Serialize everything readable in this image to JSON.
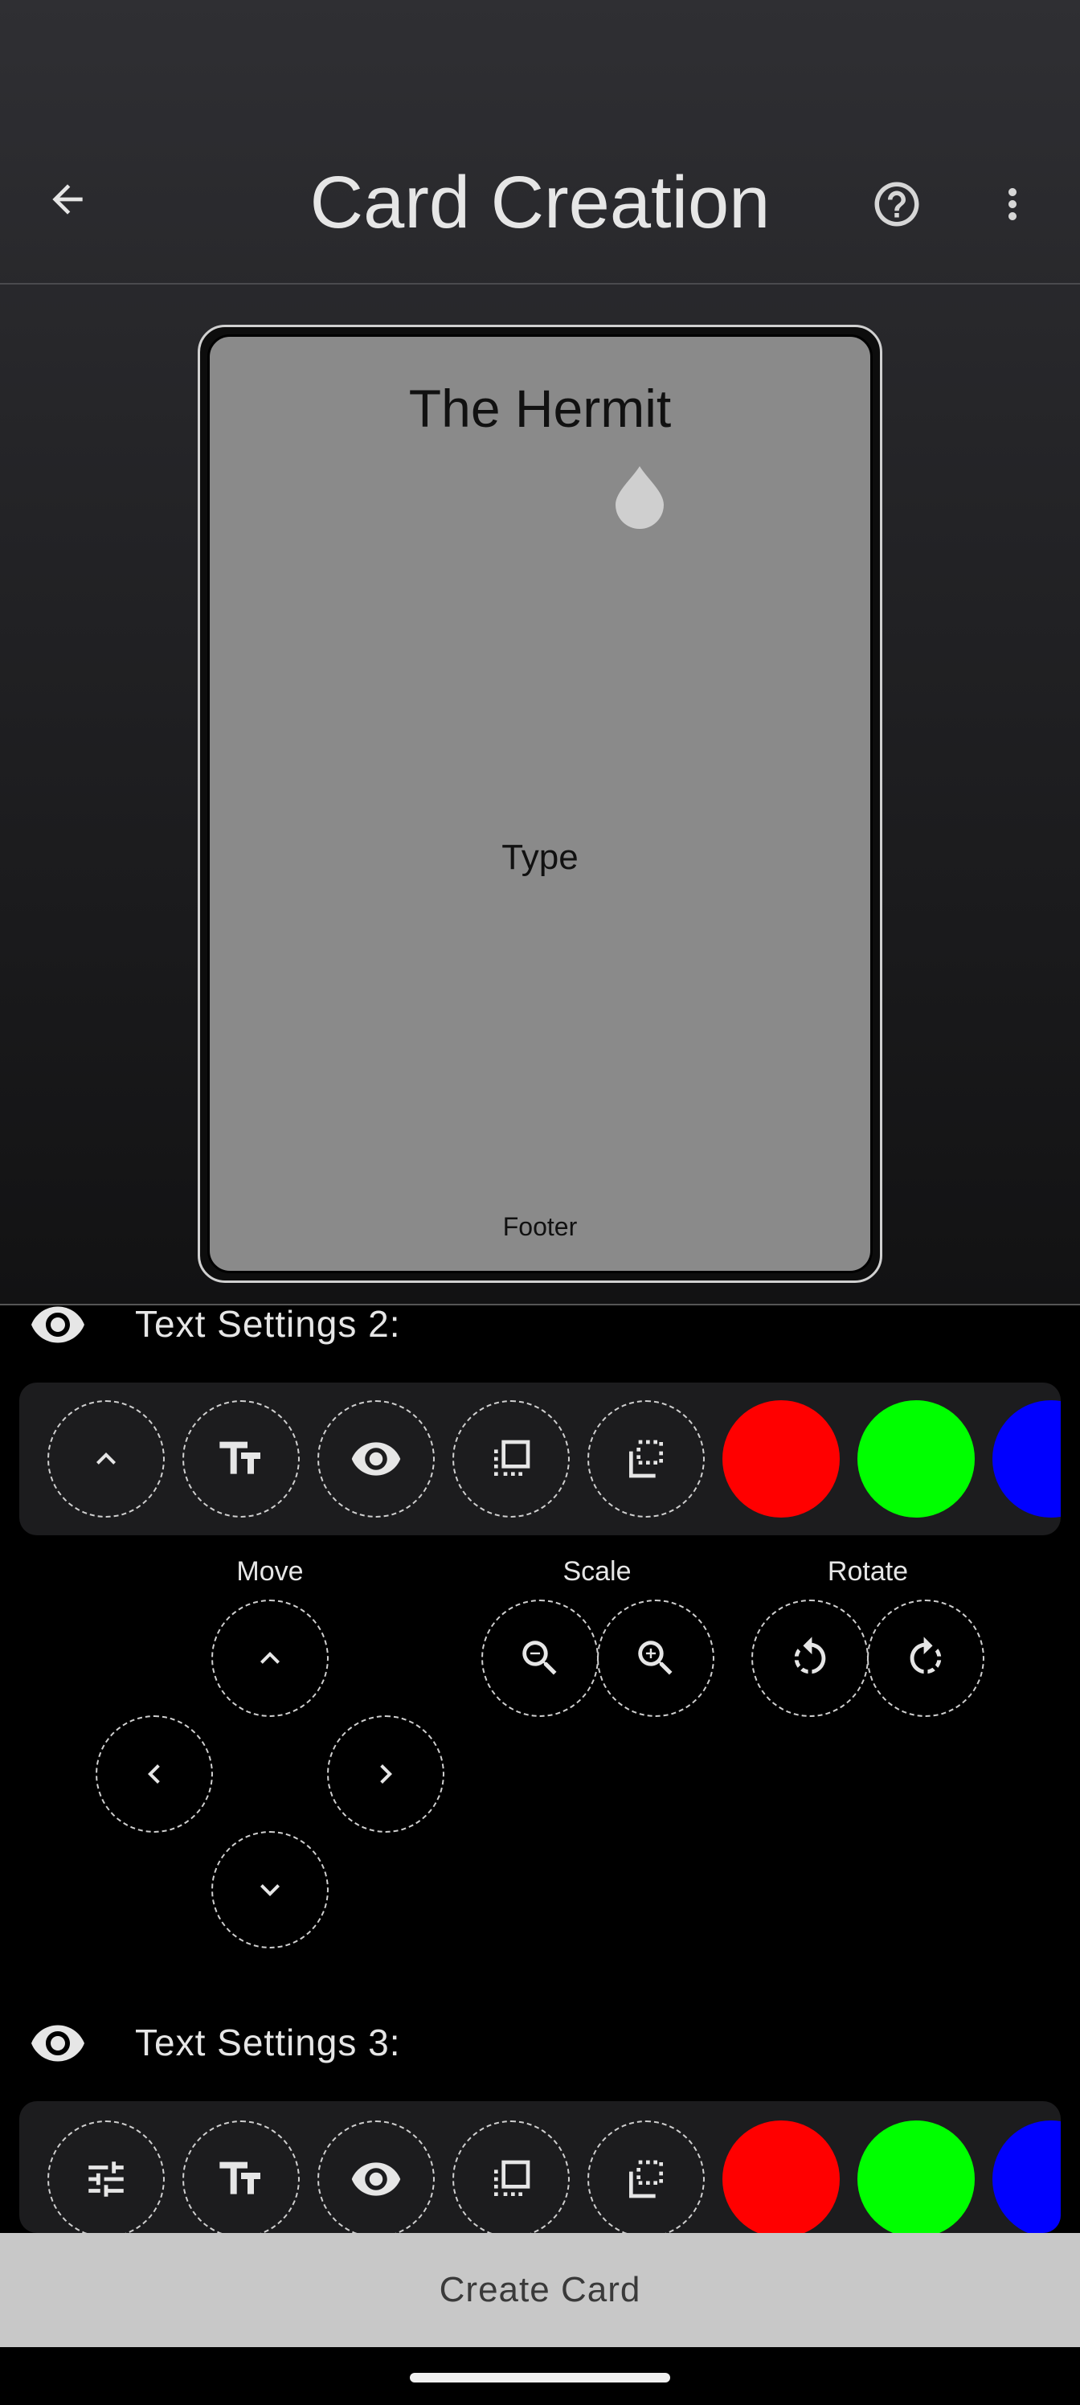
{
  "appbar": {
    "title": "Card Creation",
    "back_icon": "arrow-left-icon",
    "help_icon": "help-circle-icon",
    "menu_icon": "more-vertical-icon"
  },
  "card": {
    "title": "The Hermit",
    "type": "Type",
    "footer": "Footer",
    "symbol_icon": "water-drop-icon",
    "face_color": "#8a8a8a"
  },
  "sections": [
    {
      "title": "Text Settings 2:",
      "toolbar_icons": [
        "chevron-up-icon",
        "text-size-icon",
        "eye-icon",
        "bring-front-icon",
        "send-back-icon"
      ],
      "colors": [
        "#ff0000",
        "#00ff00",
        "#0000ff"
      ]
    },
    {
      "title": "Text Settings 3:",
      "toolbar_icons": [
        "tune-icon",
        "text-size-icon",
        "eye-icon",
        "bring-front-icon",
        "send-back-icon"
      ],
      "colors": [
        "#ff0000",
        "#00ff00",
        "#0000ff"
      ]
    }
  ],
  "controls": {
    "move_label": "Move",
    "scale_label": "Scale",
    "rotate_label": "Rotate"
  },
  "create_button": "Create Card"
}
